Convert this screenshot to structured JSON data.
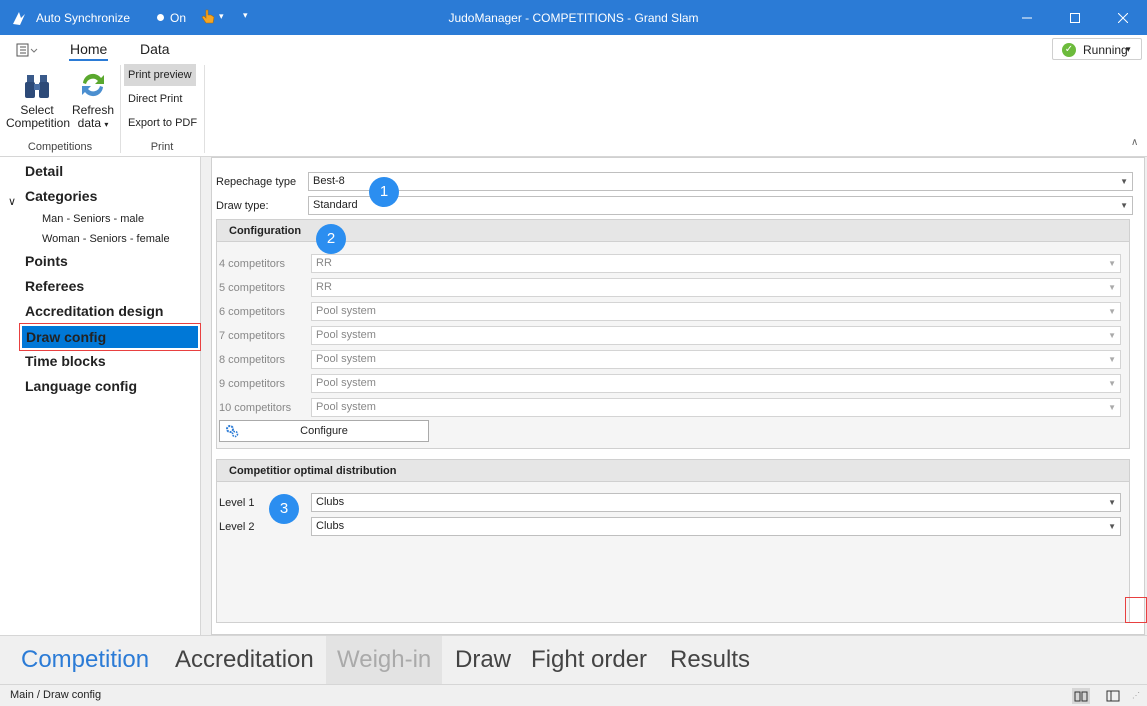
{
  "titlebar": {
    "auto_sync": "Auto Synchronize",
    "on_label": "On",
    "title": "JudoManager - COMPETITIONS - Grand Slam"
  },
  "ribbon": {
    "tabs": [
      "Home",
      "Data"
    ],
    "status": "Running",
    "select_competition": "Select\nCompetition",
    "select_line1": "Select",
    "select_line2": "Competition",
    "refresh_line1": "Refresh",
    "refresh_line2": "data",
    "group_competitions": "Competitions",
    "print_preview": "Print preview",
    "direct_print": "Direct Print",
    "export_pdf": "Export to PDF",
    "group_print": "Print"
  },
  "nav": {
    "detail": "Detail",
    "categories": "Categories",
    "sub1": "Man - Seniors - male",
    "sub2": "Woman - Seniors - female",
    "points": "Points",
    "referees": "Referees",
    "accreditation": "Accreditation design",
    "draw_config": "Draw config",
    "time_blocks": "Time blocks",
    "language_config": "Language config"
  },
  "form": {
    "repechage_label": "Repechage type",
    "repechage_value": "Best-8",
    "draw_type_label": "Draw type:",
    "draw_type_value": "Standard",
    "configuration_header": "Configuration",
    "rows": [
      {
        "label": "4 competitors",
        "value": "RR"
      },
      {
        "label": "5 competitors",
        "value": "RR"
      },
      {
        "label": "6 competitors",
        "value": "Pool system"
      },
      {
        "label": "7 competitors",
        "value": "Pool system"
      },
      {
        "label": "8 competitors",
        "value": "Pool system"
      },
      {
        "label": "9 competitors",
        "value": "Pool system"
      },
      {
        "label": "10 competitors",
        "value": "Pool system"
      }
    ],
    "configure_button": "Configure",
    "distribution_header": "Competitior optimal distribution",
    "level1_label": "Level 1",
    "level1_value": "Clubs",
    "level2_label": "Level 2",
    "level2_value": "Clubs",
    "badges": [
      "1",
      "2",
      "3"
    ]
  },
  "bottom_tabs": [
    "Competition",
    "Accreditation",
    "Weigh-in",
    "Draw",
    "Fight order",
    "Results"
  ],
  "status_bar": {
    "path": "Main / Draw config"
  },
  "colors": {
    "accent": "#2b7bd6",
    "selection": "#0078d7",
    "highlight_border": "#e84040"
  }
}
